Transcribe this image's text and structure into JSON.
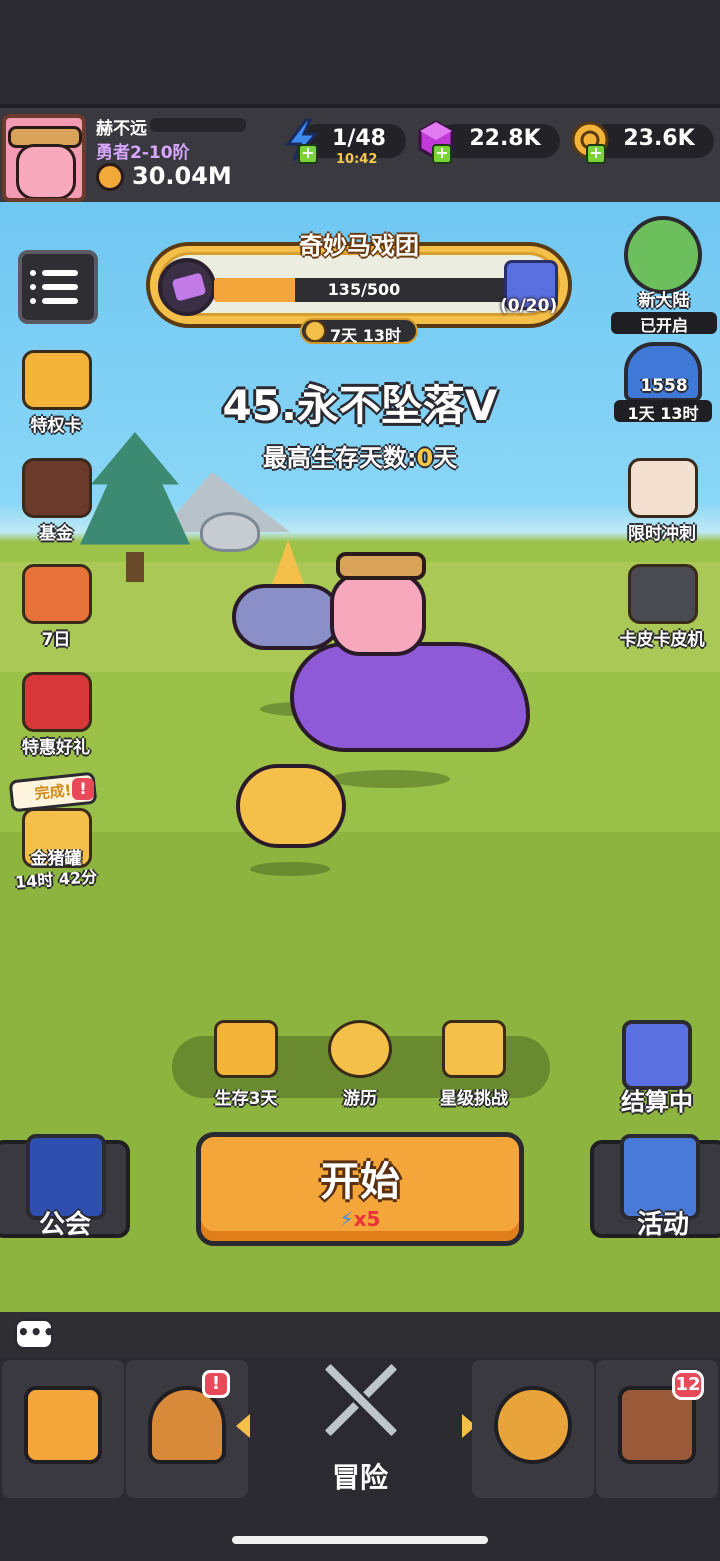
{
  "player": {
    "name": "赫不远",
    "rank": "勇者2-10阶",
    "power": "30.04M"
  },
  "resources": {
    "energy": {
      "value": "1/48",
      "timer": "10:42",
      "icon": "energy-bolt-icon",
      "color": "#3d8bf0"
    },
    "gems": {
      "value": "22.8K",
      "icon": "purple-gem-icon",
      "color": "#c03ad8"
    },
    "coins": {
      "value": "23.6K",
      "icon": "gold-coin-icon",
      "color": "#f4b43a"
    }
  },
  "event": {
    "title": "奇妙马戏团",
    "progress_text": "135/500",
    "progress_fraction": 0.27,
    "reward_count": "(0/20)",
    "timer": "7天 13时"
  },
  "stage": {
    "title": "45.永不坠落V",
    "best_survive_prefix": "最高生存天数:",
    "best_survive_days": "0",
    "best_survive_suffix": "天"
  },
  "left_side": [
    {
      "label": "特权卡",
      "icon": "privilege-card-icon"
    },
    {
      "label": "基金",
      "icon": "fund-chart-icon"
    },
    {
      "label": "7日",
      "icon": "seven-day-icon"
    },
    {
      "label": "特惠好礼",
      "icon": "gift-box-icon"
    }
  ],
  "piggy_bank": {
    "done_label": "完成!",
    "alert": "!",
    "label": "金猪罐",
    "timer": "14时 42分"
  },
  "right_side": {
    "new_land": {
      "label": "新大陆",
      "status": "已开启"
    },
    "ranking": {
      "value": "1558",
      "timer": "1天 13时"
    },
    "limited_sprint": {
      "label": "限时冲刺"
    },
    "skin_machine": {
      "label": "卡皮卡皮机"
    }
  },
  "modes": [
    {
      "label": "生存3天",
      "icon": "treasure-chest-icon"
    },
    {
      "label": "游历",
      "icon": "compass-icon"
    },
    {
      "label": "星级挑战",
      "icon": "star-challenge-icon"
    }
  ],
  "settle": {
    "label": "结算中"
  },
  "start": {
    "label": "开始",
    "cost_bolt": "⚡",
    "cost": "x5"
  },
  "guild": {
    "label": "公会"
  },
  "activity": {
    "label": "活动"
  },
  "chat": {
    "icon": "chat-bubble-icon",
    "glyph": "•••"
  },
  "nav": {
    "shop": {
      "icon": "shop-icon"
    },
    "hero": {
      "icon": "helmet-icon",
      "alert": "!"
    },
    "adventure": {
      "label": "冒险",
      "icon": "crossed-swords-icon"
    },
    "upgrade": {
      "icon": "upgrade-arrow-icon"
    },
    "treasure": {
      "icon": "treasure-icon",
      "badge": "12"
    }
  }
}
